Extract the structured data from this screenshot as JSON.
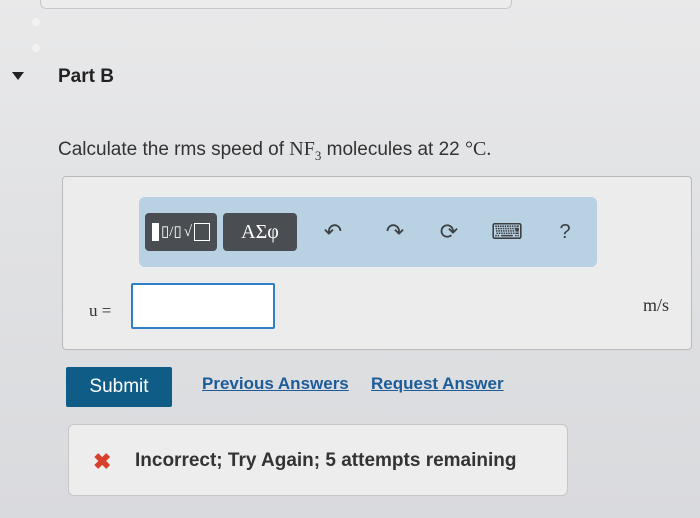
{
  "part": {
    "title": "Part B"
  },
  "question": {
    "text_before": "Calculate the rms speed of ",
    "formula": "NF",
    "formula_sub": "3",
    "text_after": " molecules at 22 ",
    "unit_temp": "°C",
    "end": "."
  },
  "toolbar": {
    "templates_icon": "templates-icon",
    "symbols_label": "ΑΣφ",
    "undo_icon": "undo-icon",
    "redo_icon": "redo-icon",
    "reset_icon": "reset-icon",
    "keyboard_icon": "keyboard-icon",
    "help_label": "?"
  },
  "answer": {
    "variable": "u =",
    "value": "",
    "unit": "m/s"
  },
  "actions": {
    "submit_label": "Submit",
    "previous_answers_label": "Previous Answers",
    "request_answer_label": "Request Answer"
  },
  "feedback": {
    "icon": "x-icon",
    "text": "Incorrect; Try Again; 5 attempts remaining",
    "status_color": "#d6412c"
  },
  "colors": {
    "toolbar_bg": "#b8d2e4",
    "submit_bg": "#0f5d86",
    "link": "#1d5c98",
    "input_border": "#2f7fc8"
  }
}
